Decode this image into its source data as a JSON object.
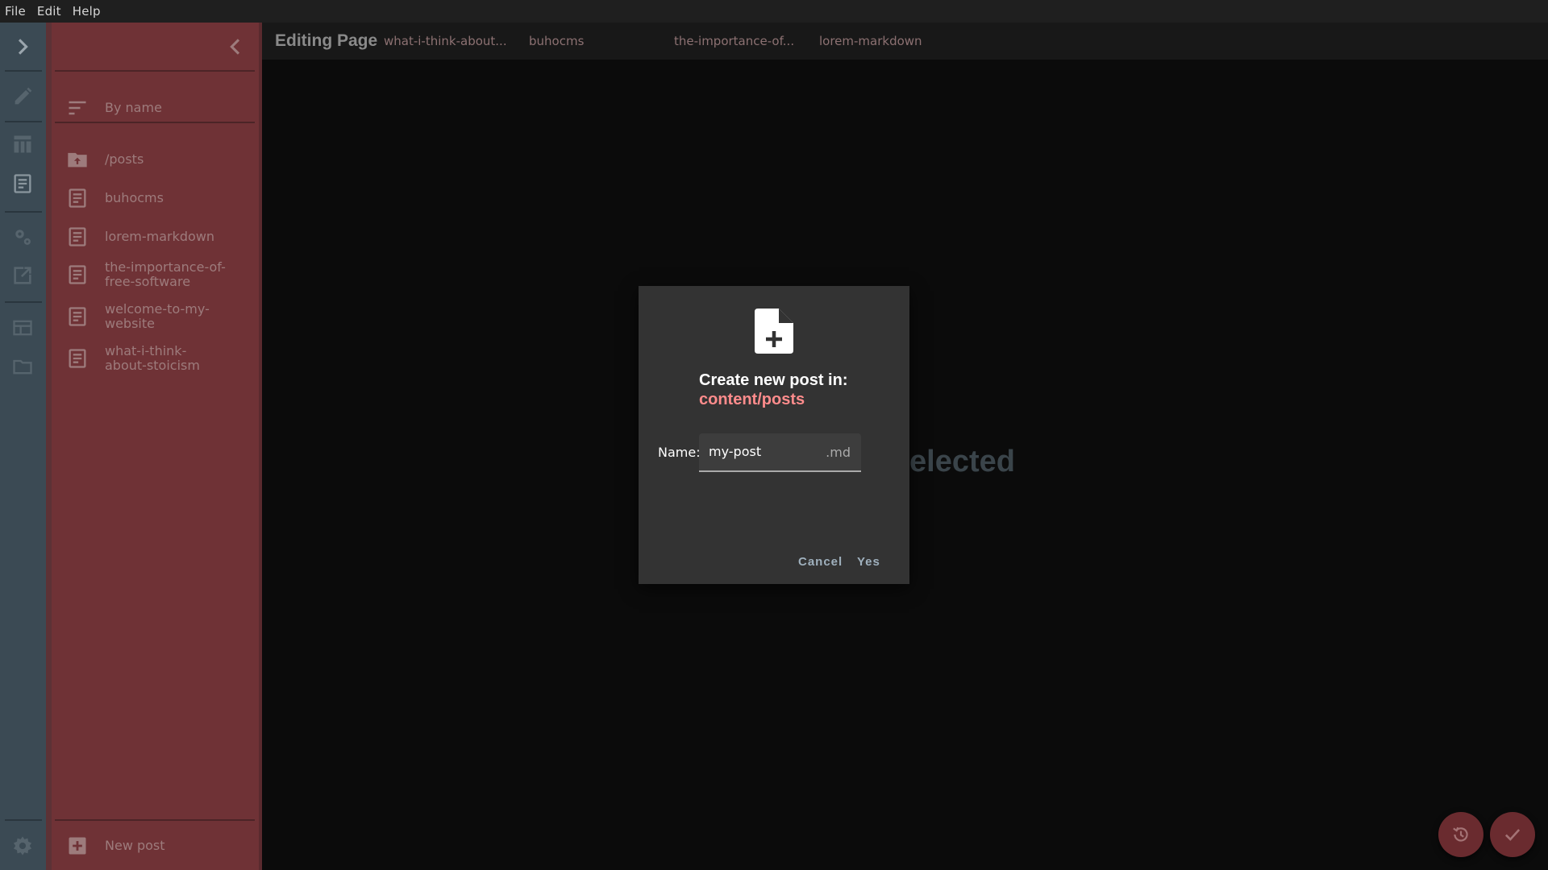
{
  "menu": [
    "File",
    "Edit",
    "Help"
  ],
  "header": {
    "title": "Editing Page",
    "tabs": [
      "what-i-think-about...",
      "buhocms",
      "the-importance-of...",
      "lorem-markdown"
    ]
  },
  "sidebar": {
    "sort_label": "By name",
    "folder_label": "/posts",
    "files": [
      "buhocms",
      "lorem-markdown",
      "the-importance-of-free-software",
      "welcome-to-my-website",
      "what-i-think-about-stoicism"
    ],
    "new_post_label": "New post"
  },
  "background_text": "elected",
  "dialog": {
    "heading": "Create new post in:",
    "path": "content/posts",
    "name_label": "Name:",
    "name_value": "my-post",
    "suffix": ".md",
    "cancel_label": "Cancel",
    "yes_label": "Yes"
  },
  "colors": {
    "accent": "#ff8c8c",
    "sidebar": "#6f3236",
    "rail": "#3b4a54"
  }
}
